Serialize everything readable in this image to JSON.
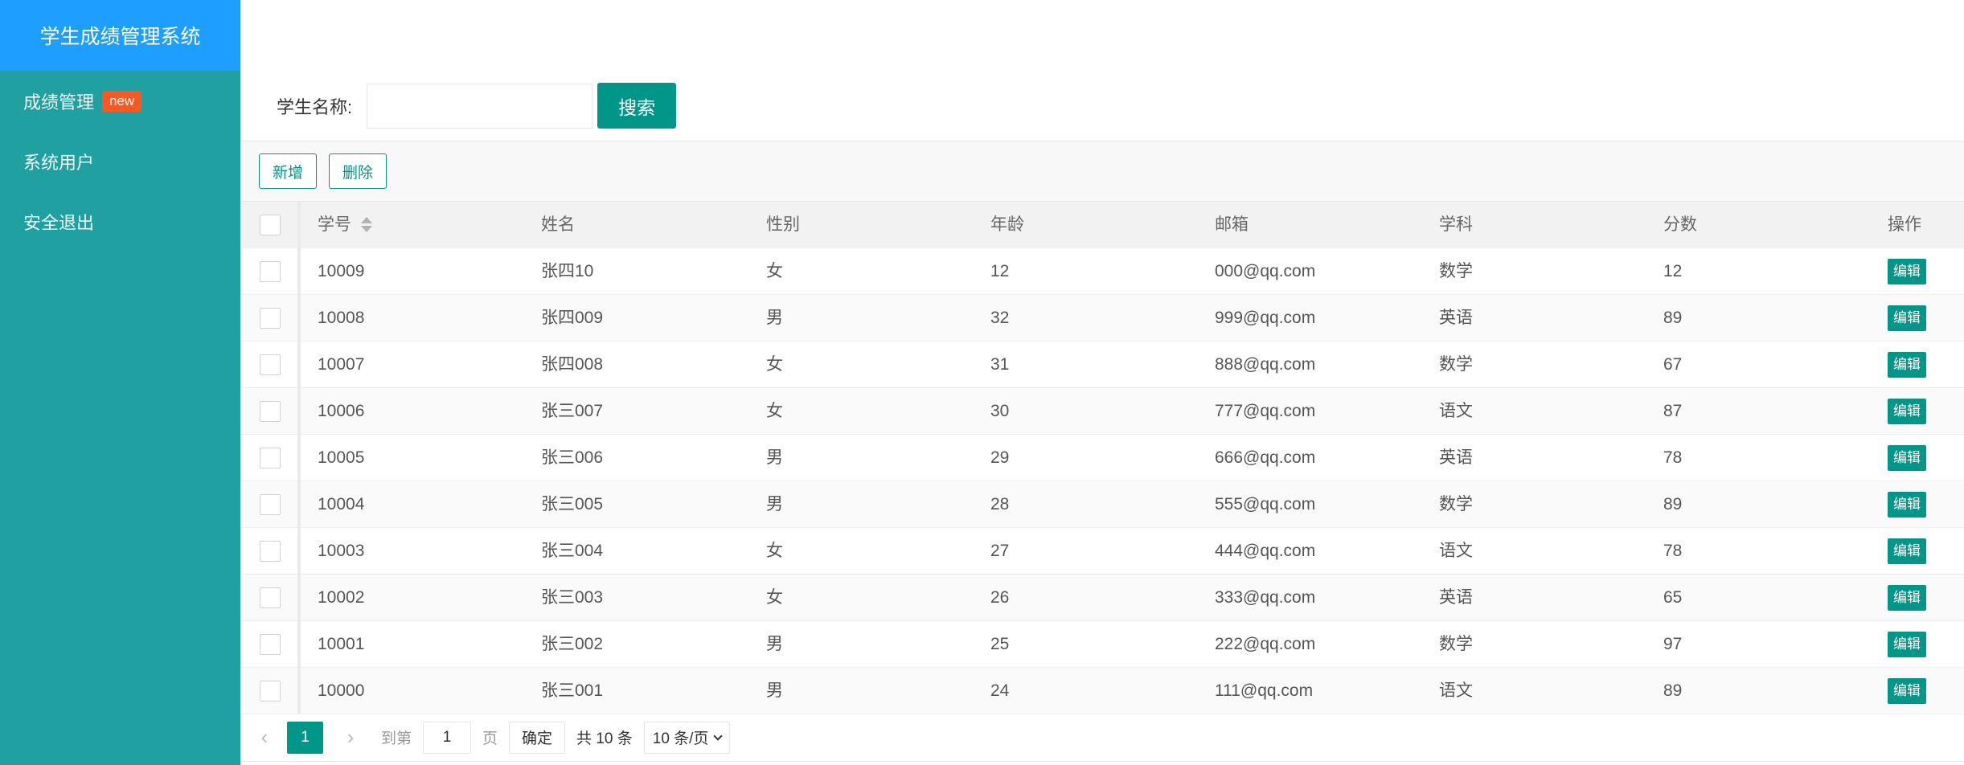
{
  "sidebar": {
    "title": "学生成绩管理系统",
    "items": [
      {
        "label": "成绩管理",
        "badge": "new"
      },
      {
        "label": "系统用户"
      },
      {
        "label": "安全退出"
      }
    ]
  },
  "search": {
    "label": "学生名称:",
    "value": "",
    "placeholder": "",
    "button": "搜索"
  },
  "toolbar": {
    "add_label": "新增",
    "delete_label": "删除"
  },
  "table": {
    "columns": [
      "学号",
      "姓名",
      "性别",
      "年龄",
      "邮箱",
      "学科",
      "分数",
      "操作"
    ],
    "edit_label": "编辑",
    "rows": [
      {
        "sid": "10009",
        "name": "张四10",
        "gender": "女",
        "age": "12",
        "email": "000@qq.com",
        "subject": "数学",
        "score": "12"
      },
      {
        "sid": "10008",
        "name": "张四009",
        "gender": "男",
        "age": "32",
        "email": "999@qq.com",
        "subject": "英语",
        "score": "89"
      },
      {
        "sid": "10007",
        "name": "张四008",
        "gender": "女",
        "age": "31",
        "email": "888@qq.com",
        "subject": "数学",
        "score": "67"
      },
      {
        "sid": "10006",
        "name": "张三007",
        "gender": "女",
        "age": "30",
        "email": "777@qq.com",
        "subject": "语文",
        "score": "87"
      },
      {
        "sid": "10005",
        "name": "张三006",
        "gender": "男",
        "age": "29",
        "email": "666@qq.com",
        "subject": "英语",
        "score": "78"
      },
      {
        "sid": "10004",
        "name": "张三005",
        "gender": "男",
        "age": "28",
        "email": "555@qq.com",
        "subject": "数学",
        "score": "89"
      },
      {
        "sid": "10003",
        "name": "张三004",
        "gender": "女",
        "age": "27",
        "email": "444@qq.com",
        "subject": "语文",
        "score": "78"
      },
      {
        "sid": "10002",
        "name": "张三003",
        "gender": "女",
        "age": "26",
        "email": "333@qq.com",
        "subject": "英语",
        "score": "65"
      },
      {
        "sid": "10001",
        "name": "张三002",
        "gender": "男",
        "age": "25",
        "email": "222@qq.com",
        "subject": "数学",
        "score": "97"
      },
      {
        "sid": "10000",
        "name": "张三001",
        "gender": "男",
        "age": "24",
        "email": "111@qq.com",
        "subject": "语文",
        "score": "89"
      }
    ]
  },
  "pagination": {
    "current_page": "1",
    "goto_label": "到第",
    "goto_value": "1",
    "page_unit": "页",
    "confirm_label": "确定",
    "total_label": "共 10 条",
    "page_size_label": "10 条/页"
  },
  "colors": {
    "sidebar_bg": "#20a0a0",
    "logo_bg": "#1e9fff",
    "primary": "#009688",
    "badge": "#ff5722"
  },
  "icons": [
    "sort-icon",
    "chevron-left-icon",
    "chevron-right-icon",
    "chevron-down-icon"
  ]
}
